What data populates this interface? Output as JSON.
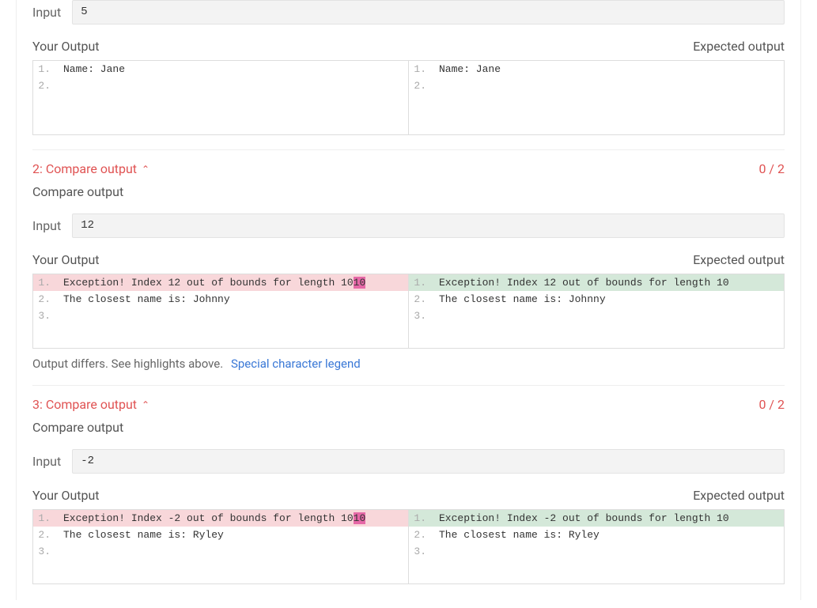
{
  "labels": {
    "input": "Input",
    "your_output": "Your Output",
    "expected_output": "Expected output",
    "differs": "Output differs. See highlights above.",
    "special_chars": "Special character legend",
    "compare_output": "Compare output"
  },
  "test1": {
    "input": "5",
    "your": {
      "l1": "Name: Jane",
      "l2": ""
    },
    "exp": {
      "l1": "Name: Jane",
      "l2": ""
    }
  },
  "test2": {
    "header_left": "2: Compare output",
    "score": "0 / 2",
    "input": "12",
    "your": {
      "l1a": "Exception! Index 12 out of bounds for length 10",
      "l1b": "10",
      "l2": "The closest name is: Johnny",
      "l3": ""
    },
    "exp": {
      "l1": "Exception! Index 12 out of bounds for length 10",
      "l2": "The closest name is: Johnny",
      "l3": ""
    }
  },
  "test3": {
    "header_left": "3: Compare output",
    "score": "0 / 2",
    "input": "-2",
    "your": {
      "l1a": "Exception! Index -2 out of bounds for length 10",
      "l1b": "10",
      "l2": "The closest name is: Ryley",
      "l3": ""
    },
    "exp": {
      "l1": "Exception! Index -2 out of bounds for length 10",
      "l2": "The closest name is: Ryley",
      "l3": ""
    }
  }
}
